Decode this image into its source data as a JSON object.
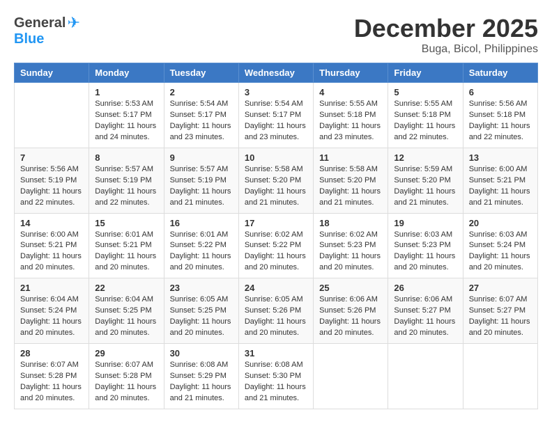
{
  "header": {
    "logo_general": "General",
    "logo_blue": "Blue",
    "month": "December 2025",
    "location": "Buga, Bicol, Philippines"
  },
  "days_of_week": [
    "Sunday",
    "Monday",
    "Tuesday",
    "Wednesday",
    "Thursday",
    "Friday",
    "Saturday"
  ],
  "weeks": [
    [
      {
        "day": "",
        "info": ""
      },
      {
        "day": "1",
        "info": "Sunrise: 5:53 AM\nSunset: 5:17 PM\nDaylight: 11 hours\nand 24 minutes."
      },
      {
        "day": "2",
        "info": "Sunrise: 5:54 AM\nSunset: 5:17 PM\nDaylight: 11 hours\nand 23 minutes."
      },
      {
        "day": "3",
        "info": "Sunrise: 5:54 AM\nSunset: 5:17 PM\nDaylight: 11 hours\nand 23 minutes."
      },
      {
        "day": "4",
        "info": "Sunrise: 5:55 AM\nSunset: 5:18 PM\nDaylight: 11 hours\nand 23 minutes."
      },
      {
        "day": "5",
        "info": "Sunrise: 5:55 AM\nSunset: 5:18 PM\nDaylight: 11 hours\nand 22 minutes."
      },
      {
        "day": "6",
        "info": "Sunrise: 5:56 AM\nSunset: 5:18 PM\nDaylight: 11 hours\nand 22 minutes."
      }
    ],
    [
      {
        "day": "7",
        "info": "Sunrise: 5:56 AM\nSunset: 5:19 PM\nDaylight: 11 hours\nand 22 minutes."
      },
      {
        "day": "8",
        "info": "Sunrise: 5:57 AM\nSunset: 5:19 PM\nDaylight: 11 hours\nand 22 minutes."
      },
      {
        "day": "9",
        "info": "Sunrise: 5:57 AM\nSunset: 5:19 PM\nDaylight: 11 hours\nand 21 minutes."
      },
      {
        "day": "10",
        "info": "Sunrise: 5:58 AM\nSunset: 5:20 PM\nDaylight: 11 hours\nand 21 minutes."
      },
      {
        "day": "11",
        "info": "Sunrise: 5:58 AM\nSunset: 5:20 PM\nDaylight: 11 hours\nand 21 minutes."
      },
      {
        "day": "12",
        "info": "Sunrise: 5:59 AM\nSunset: 5:20 PM\nDaylight: 11 hours\nand 21 minutes."
      },
      {
        "day": "13",
        "info": "Sunrise: 6:00 AM\nSunset: 5:21 PM\nDaylight: 11 hours\nand 21 minutes."
      }
    ],
    [
      {
        "day": "14",
        "info": "Sunrise: 6:00 AM\nSunset: 5:21 PM\nDaylight: 11 hours\nand 20 minutes."
      },
      {
        "day": "15",
        "info": "Sunrise: 6:01 AM\nSunset: 5:21 PM\nDaylight: 11 hours\nand 20 minutes."
      },
      {
        "day": "16",
        "info": "Sunrise: 6:01 AM\nSunset: 5:22 PM\nDaylight: 11 hours\nand 20 minutes."
      },
      {
        "day": "17",
        "info": "Sunrise: 6:02 AM\nSunset: 5:22 PM\nDaylight: 11 hours\nand 20 minutes."
      },
      {
        "day": "18",
        "info": "Sunrise: 6:02 AM\nSunset: 5:23 PM\nDaylight: 11 hours\nand 20 minutes."
      },
      {
        "day": "19",
        "info": "Sunrise: 6:03 AM\nSunset: 5:23 PM\nDaylight: 11 hours\nand 20 minutes."
      },
      {
        "day": "20",
        "info": "Sunrise: 6:03 AM\nSunset: 5:24 PM\nDaylight: 11 hours\nand 20 minutes."
      }
    ],
    [
      {
        "day": "21",
        "info": "Sunrise: 6:04 AM\nSunset: 5:24 PM\nDaylight: 11 hours\nand 20 minutes."
      },
      {
        "day": "22",
        "info": "Sunrise: 6:04 AM\nSunset: 5:25 PM\nDaylight: 11 hours\nand 20 minutes."
      },
      {
        "day": "23",
        "info": "Sunrise: 6:05 AM\nSunset: 5:25 PM\nDaylight: 11 hours\nand 20 minutes."
      },
      {
        "day": "24",
        "info": "Sunrise: 6:05 AM\nSunset: 5:26 PM\nDaylight: 11 hours\nand 20 minutes."
      },
      {
        "day": "25",
        "info": "Sunrise: 6:06 AM\nSunset: 5:26 PM\nDaylight: 11 hours\nand 20 minutes."
      },
      {
        "day": "26",
        "info": "Sunrise: 6:06 AM\nSunset: 5:27 PM\nDaylight: 11 hours\nand 20 minutes."
      },
      {
        "day": "27",
        "info": "Sunrise: 6:07 AM\nSunset: 5:27 PM\nDaylight: 11 hours\nand 20 minutes."
      }
    ],
    [
      {
        "day": "28",
        "info": "Sunrise: 6:07 AM\nSunset: 5:28 PM\nDaylight: 11 hours\nand 20 minutes."
      },
      {
        "day": "29",
        "info": "Sunrise: 6:07 AM\nSunset: 5:28 PM\nDaylight: 11 hours\nand 20 minutes."
      },
      {
        "day": "30",
        "info": "Sunrise: 6:08 AM\nSunset: 5:29 PM\nDaylight: 11 hours\nand 21 minutes."
      },
      {
        "day": "31",
        "info": "Sunrise: 6:08 AM\nSunset: 5:30 PM\nDaylight: 11 hours\nand 21 minutes."
      },
      {
        "day": "",
        "info": ""
      },
      {
        "day": "",
        "info": ""
      },
      {
        "day": "",
        "info": ""
      }
    ]
  ]
}
